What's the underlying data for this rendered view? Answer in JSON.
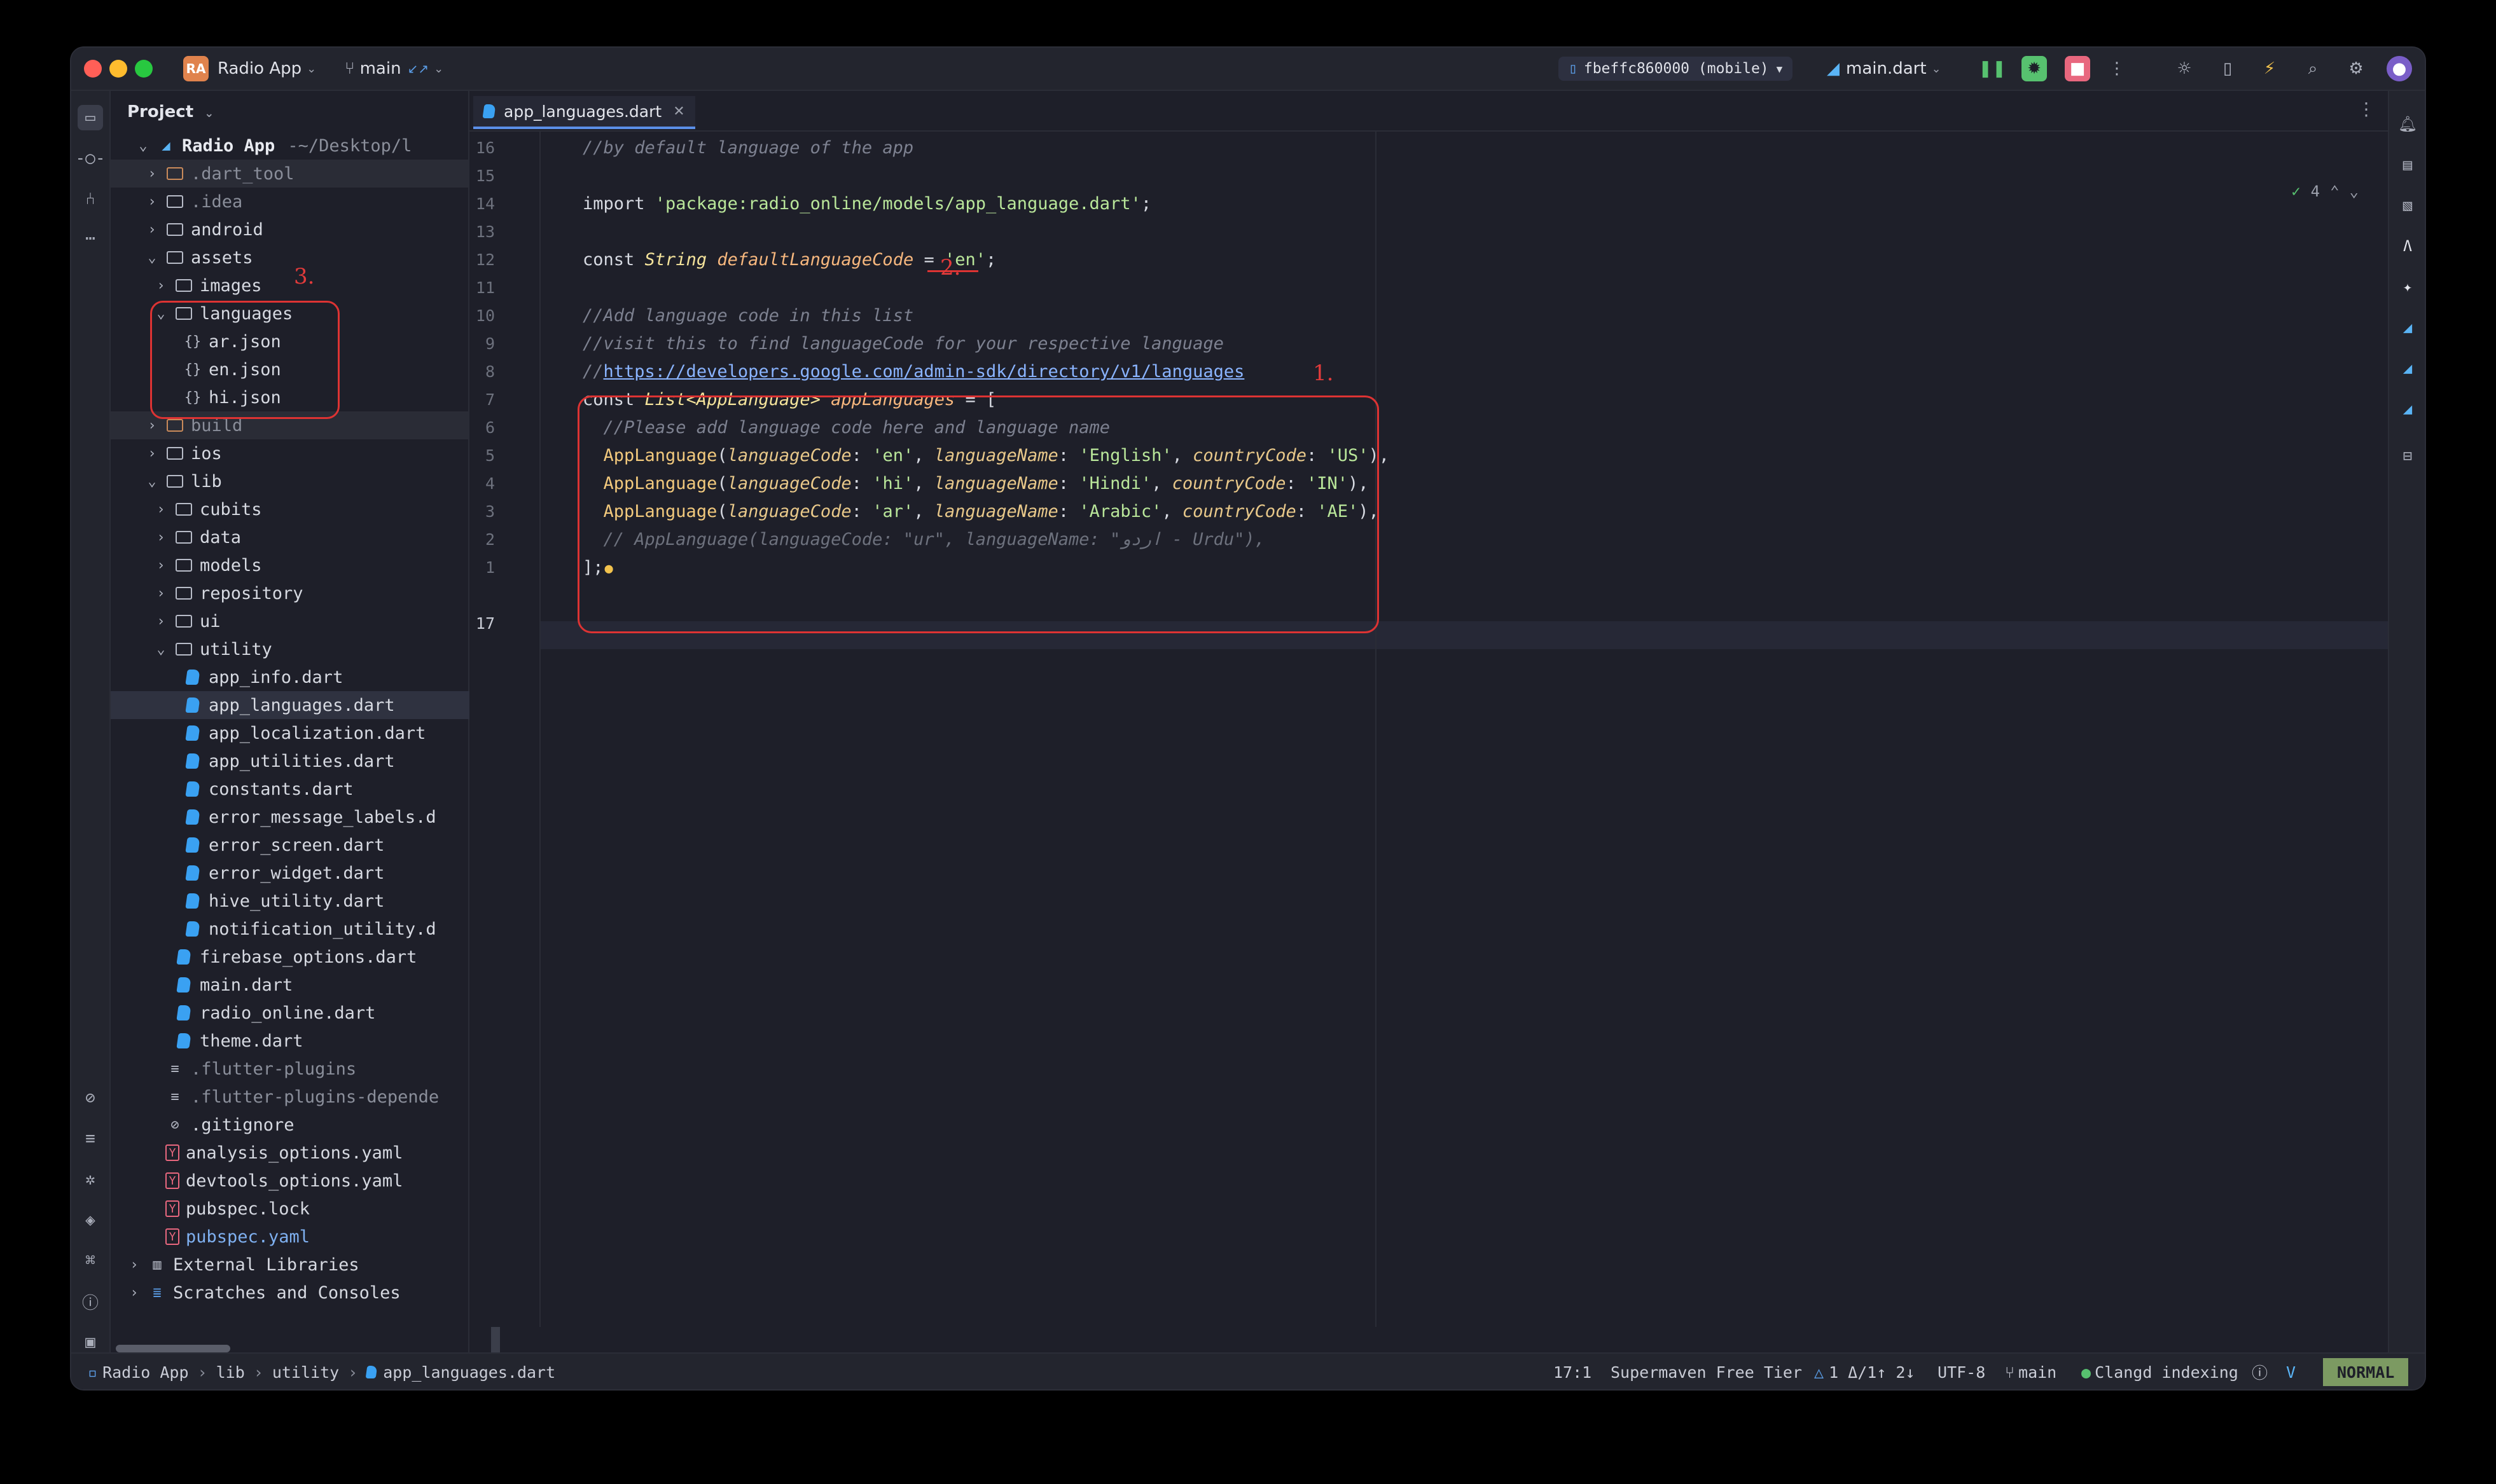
{
  "window": {
    "project_name": "Radio App",
    "project_badge": "RA",
    "branch": "main",
    "branch_arrows": "↙↗",
    "device": "fbeffc860000 (mobile)",
    "run_config": "main.dart"
  },
  "project_panel": {
    "title": "Project",
    "root": "Radio App",
    "root_path": "~/Desktop/l",
    "items": [
      {
        "label": ".dart_tool",
        "type": "folder"
      },
      {
        "label": ".idea",
        "type": "folder"
      },
      {
        "label": "android",
        "type": "folder"
      },
      {
        "label": "assets",
        "type": "folder"
      },
      {
        "label": "images",
        "type": "folder"
      },
      {
        "label": "languages",
        "type": "folder"
      },
      {
        "label": "ar.json",
        "type": "json"
      },
      {
        "label": "en.json",
        "type": "json"
      },
      {
        "label": "hi.json",
        "type": "json"
      },
      {
        "label": "build",
        "type": "folder"
      },
      {
        "label": "ios",
        "type": "folder"
      },
      {
        "label": "lib",
        "type": "folder"
      },
      {
        "label": "cubits",
        "type": "folder"
      },
      {
        "label": "data",
        "type": "folder"
      },
      {
        "label": "models",
        "type": "folder"
      },
      {
        "label": "repository",
        "type": "folder"
      },
      {
        "label": "ui",
        "type": "folder"
      },
      {
        "label": "utility",
        "type": "folder"
      },
      {
        "label": "app_info.dart",
        "type": "dart"
      },
      {
        "label": "app_languages.dart",
        "type": "dart"
      },
      {
        "label": "app_localization.dart",
        "type": "dart"
      },
      {
        "label": "app_utilities.dart",
        "type": "dart"
      },
      {
        "label": "constants.dart",
        "type": "dart"
      },
      {
        "label": "error_message_labels.d",
        "type": "dart"
      },
      {
        "label": "error_screen.dart",
        "type": "dart"
      },
      {
        "label": "error_widget.dart",
        "type": "dart"
      },
      {
        "label": "hive_utility.dart",
        "type": "dart"
      },
      {
        "label": "notification_utility.d",
        "type": "dart"
      },
      {
        "label": "firebase_options.dart",
        "type": "dart"
      },
      {
        "label": "main.dart",
        "type": "dart"
      },
      {
        "label": "radio_online.dart",
        "type": "dart"
      },
      {
        "label": "theme.dart",
        "type": "dart"
      },
      {
        "label": ".flutter-plugins",
        "type": "text"
      },
      {
        "label": ".flutter-plugins-depende",
        "type": "text"
      },
      {
        "label": ".gitignore",
        "type": "ignore"
      },
      {
        "label": "analysis_options.yaml",
        "type": "yaml"
      },
      {
        "label": "devtools_options.yaml",
        "type": "yaml"
      },
      {
        "label": "pubspec.lock",
        "type": "yaml"
      },
      {
        "label": "pubspec.yaml",
        "type": "yaml"
      },
      {
        "label": "External Libraries",
        "type": "lib"
      },
      {
        "label": "Scratches and Consoles",
        "type": "scratch"
      }
    ]
  },
  "editor": {
    "tab_label": "app_languages.dart",
    "inspections": "4",
    "line_numbers": [
      "16",
      "15",
      "14",
      "13",
      "12",
      "11",
      "10",
      "9",
      "8",
      "7",
      "6",
      "5",
      "4",
      "3",
      "2",
      "1",
      "17"
    ],
    "lines": {
      "l16": "//by default language of the app",
      "l14_kw": "import ",
      "l14_str": "'package:radio_online/models/app_language.dart'",
      "l14_end": ";",
      "l12_kw": "const ",
      "l12_type": "String",
      "l12_ident": " defaultLanguageCode",
      "l12_eq": " = ",
      "l12_str": "'en'",
      "l12_end": ";",
      "l10": "//Add language code in this list",
      "l9": "//visit this to find languageCode for your respective language",
      "l8_prefix": "//",
      "l8_link": "https://developers.google.com/admin-sdk/directory/v1/languages",
      "l7_kw": "const ",
      "l7_type": "List<AppLanguage>",
      "l7_ident": " appLanguages",
      "l7_end": " = [",
      "l6": "  //Please add language code here and language name",
      "l5": [
        "  ",
        "AppLanguage",
        "(",
        "languageCode",
        ": ",
        "'en'",
        ", ",
        "languageName",
        ": ",
        "'English'",
        ", ",
        "countryCode",
        ": ",
        "'US'",
        "),"
      ],
      "l4": [
        "  ",
        "AppLanguage",
        "(",
        "languageCode",
        ": ",
        "'hi'",
        ", ",
        "languageName",
        ": ",
        "'Hindi'",
        ", ",
        "countryCode",
        ": ",
        "'IN'",
        "),"
      ],
      "l3": [
        "  ",
        "AppLanguage",
        "(",
        "languageCode",
        ": ",
        "'ar'",
        ", ",
        "languageName",
        ": ",
        "'Arabic'",
        ", ",
        "countryCode",
        ": ",
        "'AE'",
        "),"
      ],
      "l2": "  // AppLanguage(languageCode: \"ur\", languageName: \"اردو - Urdu\"),",
      "l1": "];"
    },
    "annotations": {
      "a1": "1.",
      "a2": "2.",
      "a3": "3."
    }
  },
  "breadcrumb": [
    "Radio App",
    "lib",
    "utility",
    "app_languages.dart"
  ],
  "status": {
    "position": "17:1",
    "plugin": "Supermaven Free Tier",
    "vcs_info": "1 Δ/1↑ 2↓",
    "encoding": "UTF-8",
    "branch": "main",
    "indexing": "Clangd indexing",
    "mode": "NORMAL"
  },
  "colors": {
    "background": "#1e1f29",
    "accent": "#5b8fe8",
    "annotation": "#d33333",
    "mode_badge": "#7c9a62"
  }
}
